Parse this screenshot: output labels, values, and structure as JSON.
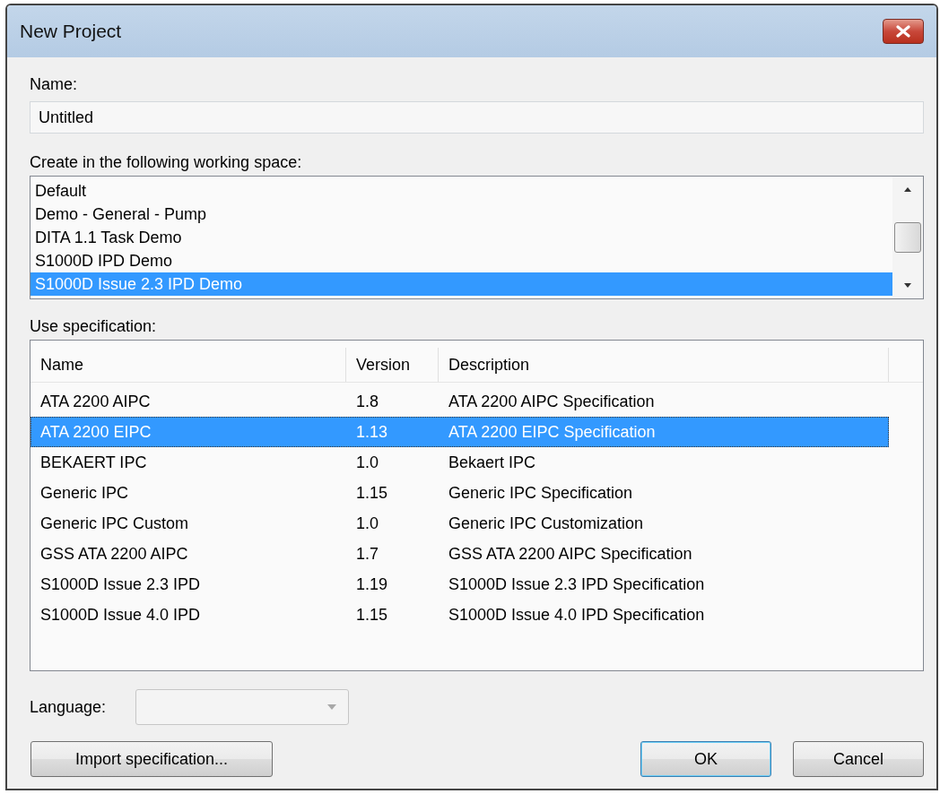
{
  "window": {
    "title": "New Project"
  },
  "name_field": {
    "label": "Name:",
    "value": "Untitled"
  },
  "workspace": {
    "label": "Create in the following working space:",
    "items": [
      {
        "label": "Default",
        "selected": false
      },
      {
        "label": "Demo - General - Pump",
        "selected": false
      },
      {
        "label": "DITA 1.1 Task Demo",
        "selected": false
      },
      {
        "label": "S1000D IPD Demo",
        "selected": false
      },
      {
        "label": "S1000D Issue 2.3 IPD Demo",
        "selected": true
      }
    ]
  },
  "specification": {
    "label": "Use specification:",
    "columns": [
      "Name",
      "Version",
      "Description"
    ],
    "rows": [
      {
        "cells": [
          "ATA 2200 AIPC",
          "1.8",
          "ATA 2200 AIPC Specification"
        ],
        "selected": false
      },
      {
        "cells": [
          "ATA 2200 EIPC",
          "1.13",
          "ATA 2200 EIPC Specification"
        ],
        "selected": true
      },
      {
        "cells": [
          "BEKAERT IPC",
          "1.0",
          "Bekaert IPC"
        ],
        "selected": false
      },
      {
        "cells": [
          "Generic IPC",
          "1.15",
          "Generic IPC Specification"
        ],
        "selected": false
      },
      {
        "cells": [
          "Generic IPC Custom",
          "1.0",
          "Generic IPC Customization"
        ],
        "selected": false
      },
      {
        "cells": [
          "GSS ATA 2200 AIPC",
          "1.7",
          "GSS ATA 2200 AIPC Specification"
        ],
        "selected": false
      },
      {
        "cells": [
          "S1000D Issue 2.3 IPD",
          "1.19",
          "S1000D Issue 2.3 IPD Specification"
        ],
        "selected": false
      },
      {
        "cells": [
          "S1000D Issue 4.0 IPD",
          "1.15",
          "S1000D Issue 4.0 IPD Specification"
        ],
        "selected": false
      }
    ]
  },
  "language": {
    "label": "Language:",
    "disabled": true
  },
  "buttons": [
    {
      "label": "Import specification...",
      "kind": "left",
      "default": false
    },
    {
      "label": "OK",
      "kind": "right",
      "default": true
    },
    {
      "label": "Cancel",
      "kind": "right",
      "default": false
    }
  ]
}
